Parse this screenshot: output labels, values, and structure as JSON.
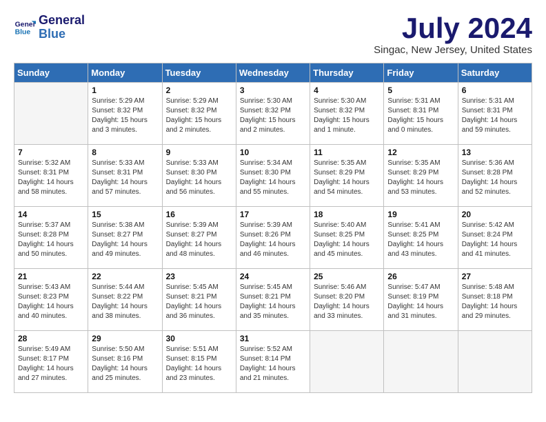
{
  "header": {
    "logo_line1": "General",
    "logo_line2": "Blue",
    "month_title": "July 2024",
    "location": "Singac, New Jersey, United States"
  },
  "weekdays": [
    "Sunday",
    "Monday",
    "Tuesday",
    "Wednesday",
    "Thursday",
    "Friday",
    "Saturday"
  ],
  "weeks": [
    [
      {
        "day": "",
        "info": ""
      },
      {
        "day": "1",
        "info": "Sunrise: 5:29 AM\nSunset: 8:32 PM\nDaylight: 15 hours\nand 3 minutes."
      },
      {
        "day": "2",
        "info": "Sunrise: 5:29 AM\nSunset: 8:32 PM\nDaylight: 15 hours\nand 2 minutes."
      },
      {
        "day": "3",
        "info": "Sunrise: 5:30 AM\nSunset: 8:32 PM\nDaylight: 15 hours\nand 2 minutes."
      },
      {
        "day": "4",
        "info": "Sunrise: 5:30 AM\nSunset: 8:32 PM\nDaylight: 15 hours\nand 1 minute."
      },
      {
        "day": "5",
        "info": "Sunrise: 5:31 AM\nSunset: 8:31 PM\nDaylight: 15 hours\nand 0 minutes."
      },
      {
        "day": "6",
        "info": "Sunrise: 5:31 AM\nSunset: 8:31 PM\nDaylight: 14 hours\nand 59 minutes."
      }
    ],
    [
      {
        "day": "7",
        "info": "Sunrise: 5:32 AM\nSunset: 8:31 PM\nDaylight: 14 hours\nand 58 minutes."
      },
      {
        "day": "8",
        "info": "Sunrise: 5:33 AM\nSunset: 8:31 PM\nDaylight: 14 hours\nand 57 minutes."
      },
      {
        "day": "9",
        "info": "Sunrise: 5:33 AM\nSunset: 8:30 PM\nDaylight: 14 hours\nand 56 minutes."
      },
      {
        "day": "10",
        "info": "Sunrise: 5:34 AM\nSunset: 8:30 PM\nDaylight: 14 hours\nand 55 minutes."
      },
      {
        "day": "11",
        "info": "Sunrise: 5:35 AM\nSunset: 8:29 PM\nDaylight: 14 hours\nand 54 minutes."
      },
      {
        "day": "12",
        "info": "Sunrise: 5:35 AM\nSunset: 8:29 PM\nDaylight: 14 hours\nand 53 minutes."
      },
      {
        "day": "13",
        "info": "Sunrise: 5:36 AM\nSunset: 8:28 PM\nDaylight: 14 hours\nand 52 minutes."
      }
    ],
    [
      {
        "day": "14",
        "info": "Sunrise: 5:37 AM\nSunset: 8:28 PM\nDaylight: 14 hours\nand 50 minutes."
      },
      {
        "day": "15",
        "info": "Sunrise: 5:38 AM\nSunset: 8:27 PM\nDaylight: 14 hours\nand 49 minutes."
      },
      {
        "day": "16",
        "info": "Sunrise: 5:39 AM\nSunset: 8:27 PM\nDaylight: 14 hours\nand 48 minutes."
      },
      {
        "day": "17",
        "info": "Sunrise: 5:39 AM\nSunset: 8:26 PM\nDaylight: 14 hours\nand 46 minutes."
      },
      {
        "day": "18",
        "info": "Sunrise: 5:40 AM\nSunset: 8:25 PM\nDaylight: 14 hours\nand 45 minutes."
      },
      {
        "day": "19",
        "info": "Sunrise: 5:41 AM\nSunset: 8:25 PM\nDaylight: 14 hours\nand 43 minutes."
      },
      {
        "day": "20",
        "info": "Sunrise: 5:42 AM\nSunset: 8:24 PM\nDaylight: 14 hours\nand 41 minutes."
      }
    ],
    [
      {
        "day": "21",
        "info": "Sunrise: 5:43 AM\nSunset: 8:23 PM\nDaylight: 14 hours\nand 40 minutes."
      },
      {
        "day": "22",
        "info": "Sunrise: 5:44 AM\nSunset: 8:22 PM\nDaylight: 14 hours\nand 38 minutes."
      },
      {
        "day": "23",
        "info": "Sunrise: 5:45 AM\nSunset: 8:21 PM\nDaylight: 14 hours\nand 36 minutes."
      },
      {
        "day": "24",
        "info": "Sunrise: 5:45 AM\nSunset: 8:21 PM\nDaylight: 14 hours\nand 35 minutes."
      },
      {
        "day": "25",
        "info": "Sunrise: 5:46 AM\nSunset: 8:20 PM\nDaylight: 14 hours\nand 33 minutes."
      },
      {
        "day": "26",
        "info": "Sunrise: 5:47 AM\nSunset: 8:19 PM\nDaylight: 14 hours\nand 31 minutes."
      },
      {
        "day": "27",
        "info": "Sunrise: 5:48 AM\nSunset: 8:18 PM\nDaylight: 14 hours\nand 29 minutes."
      }
    ],
    [
      {
        "day": "28",
        "info": "Sunrise: 5:49 AM\nSunset: 8:17 PM\nDaylight: 14 hours\nand 27 minutes."
      },
      {
        "day": "29",
        "info": "Sunrise: 5:50 AM\nSunset: 8:16 PM\nDaylight: 14 hours\nand 25 minutes."
      },
      {
        "day": "30",
        "info": "Sunrise: 5:51 AM\nSunset: 8:15 PM\nDaylight: 14 hours\nand 23 minutes."
      },
      {
        "day": "31",
        "info": "Sunrise: 5:52 AM\nSunset: 8:14 PM\nDaylight: 14 hours\nand 21 minutes."
      },
      {
        "day": "",
        "info": ""
      },
      {
        "day": "",
        "info": ""
      },
      {
        "day": "",
        "info": ""
      }
    ]
  ]
}
